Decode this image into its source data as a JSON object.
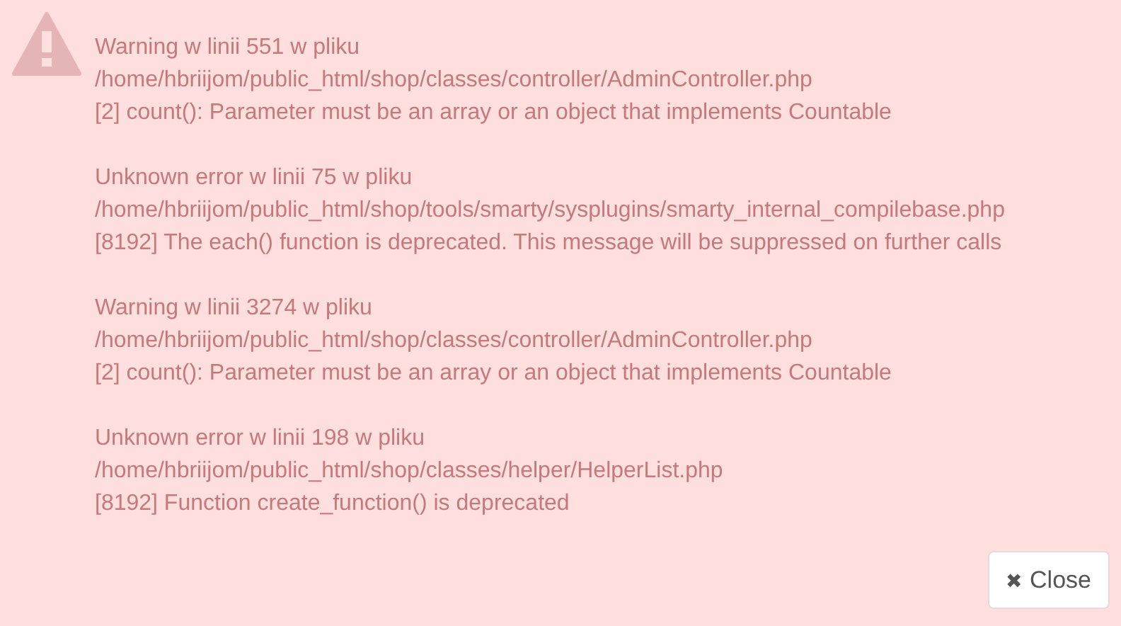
{
  "errors": [
    {
      "heading": "Warning w linii 551 w pliku",
      "path": "/home/hbriijom/public_html/shop/classes/controller/AdminController.php",
      "message": "[2] count(): Parameter must be an array or an object that implements Countable"
    },
    {
      "heading": "Unknown error w linii 75 w pliku",
      "path": "/home/hbriijom/public_html/shop/tools/smarty/sysplugins/smarty_internal_compilebase.php",
      "message": "[8192] The each() function is deprecated. This message will be suppressed on further calls"
    },
    {
      "heading": "Warning w linii 3274 w pliku",
      "path": "/home/hbriijom/public_html/shop/classes/controller/AdminController.php",
      "message": "[2] count(): Parameter must be an array or an object that implements Countable"
    },
    {
      "heading": "Unknown error w linii 198 w pliku",
      "path": "/home/hbriijom/public_html/shop/classes/helper/HelperList.php",
      "message": "[8192] Function create_function() is deprecated"
    }
  ],
  "close_button": {
    "icon": "✖",
    "label": "Close"
  }
}
